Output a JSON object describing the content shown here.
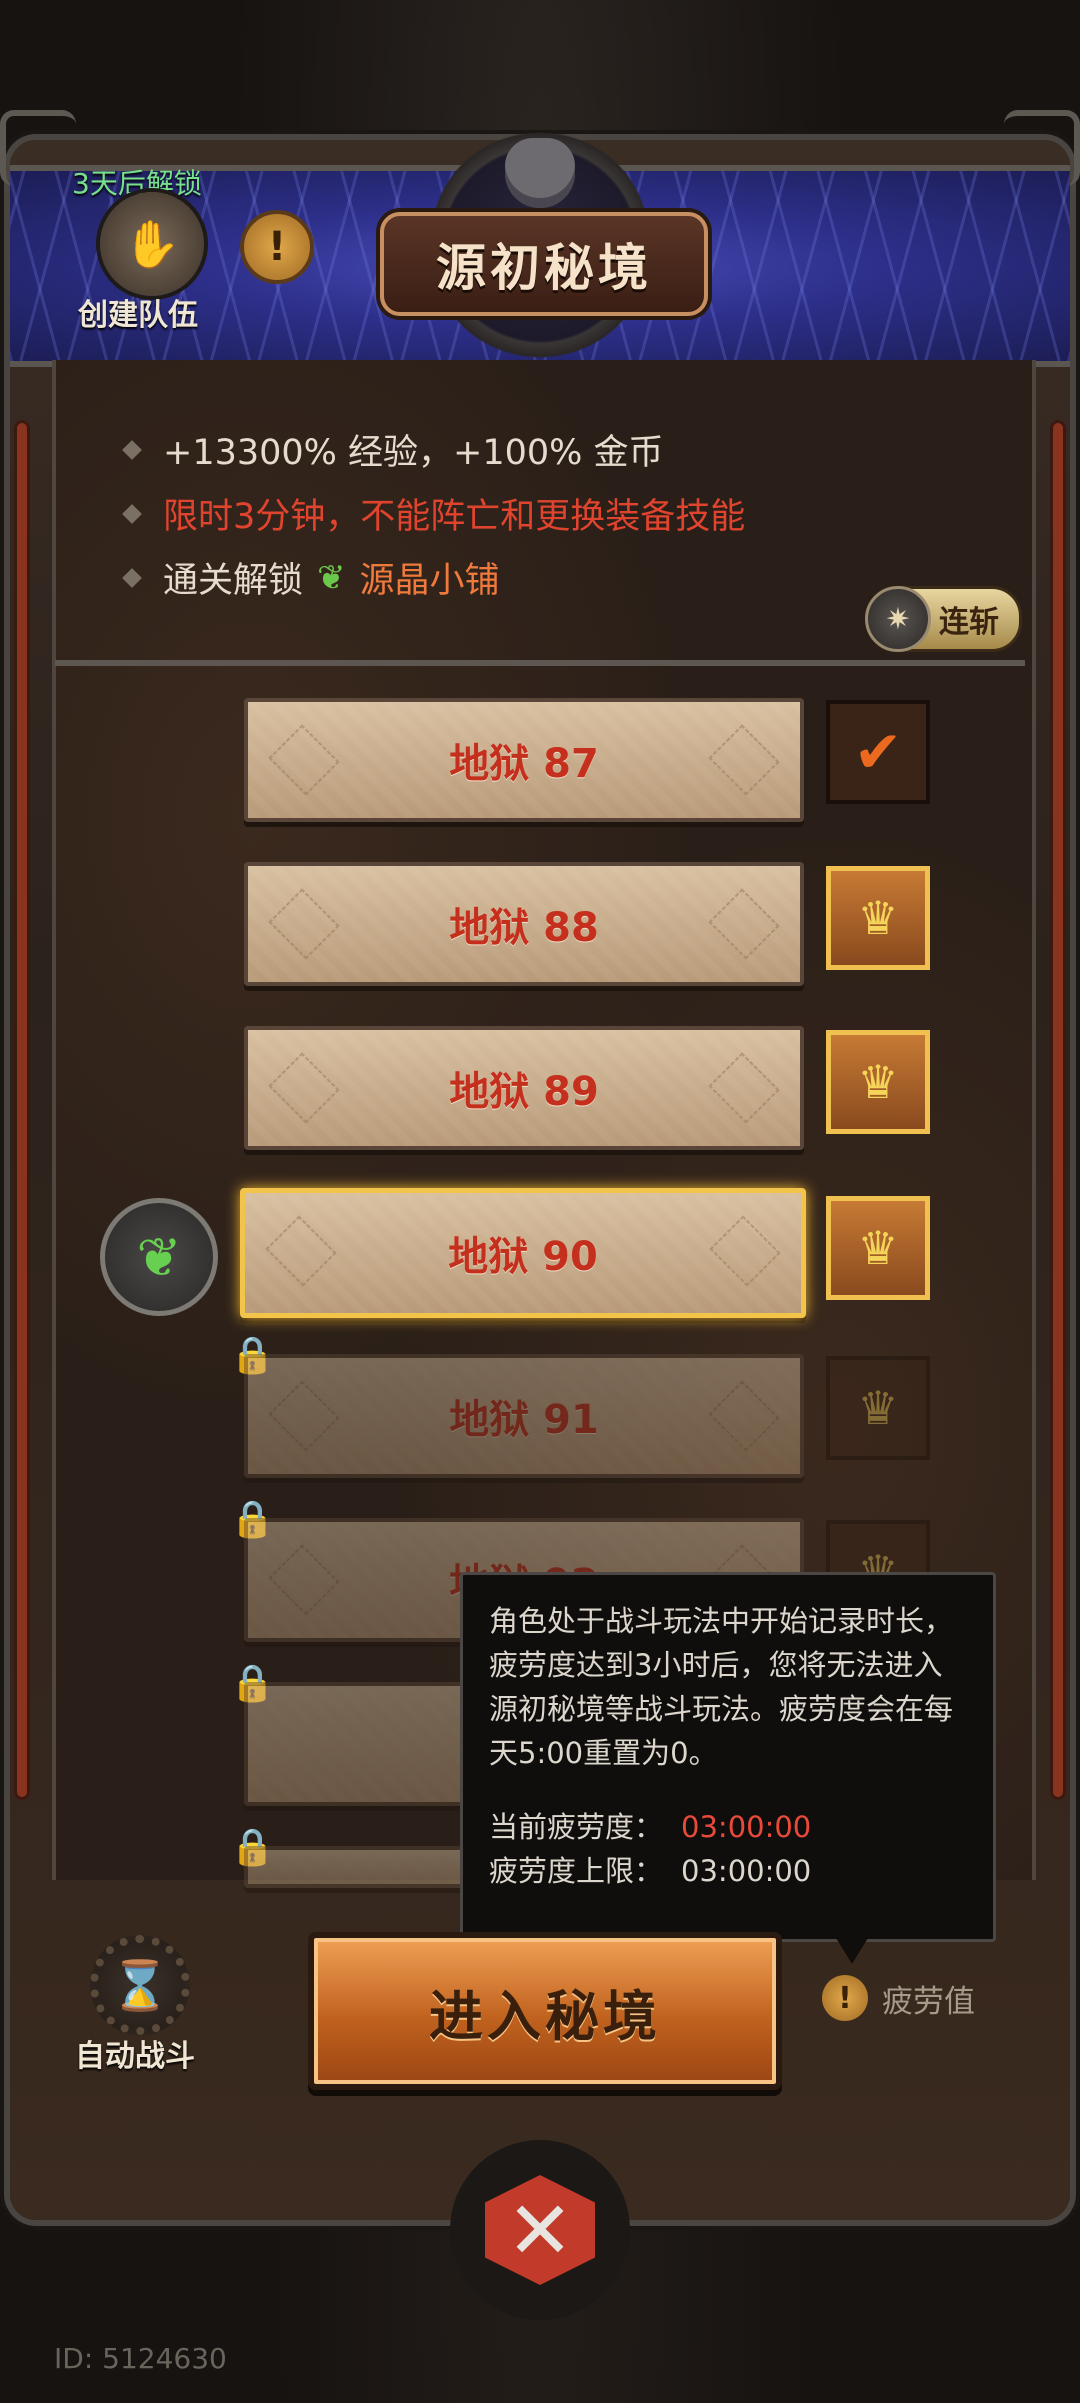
{
  "header": {
    "title": "源初秘境",
    "team_lock_text": "3天后解锁",
    "team_label": "创建队伍",
    "warning_symbol": "!"
  },
  "info": {
    "line1": "+13300% 经验，+100% 金币",
    "line2": "限时3分钟，不能阵亡和更换装备技能",
    "line3_prefix": "通关解锁",
    "line3_link": "源晶小铺"
  },
  "combo_button": {
    "label": "连斩"
  },
  "levels": [
    {
      "label": "地狱 87",
      "state": "cleared"
    },
    {
      "label": "地狱 88",
      "state": "reward"
    },
    {
      "label": "地狱 89",
      "state": "reward"
    },
    {
      "label": "地狱 90",
      "state": "current"
    },
    {
      "label": "地狱 91",
      "state": "locked"
    },
    {
      "label": "地狱 92",
      "state": "locked"
    }
  ],
  "tooltip": {
    "body": "角色处于战斗玩法中开始记录时长，疲劳度达到3小时后，您将无法进入源初秘境等战斗玩法。疲劳度会在每天5:00重置为0。",
    "current_label": "当前疲劳度：",
    "current_value": "03:00:00",
    "limit_label": "疲劳度上限：",
    "limit_value": "03:00:00"
  },
  "bottom": {
    "enter_label": "进入秘境",
    "auto_battle_label": "自动战斗",
    "fatigue_label": "疲劳值"
  },
  "user_id": "ID: 5124630",
  "colors": {
    "banner": "#2d2f8a",
    "level_text": "#c5301e",
    "warning_text": "#e0442e",
    "accent_gold": "#f2c44a"
  },
  "icons": {
    "check": "checkmark-icon",
    "chest": "treasure-chest-icon",
    "lock": "lock-icon",
    "crystal": "green-crystal-icon",
    "close": "close-x-icon"
  }
}
